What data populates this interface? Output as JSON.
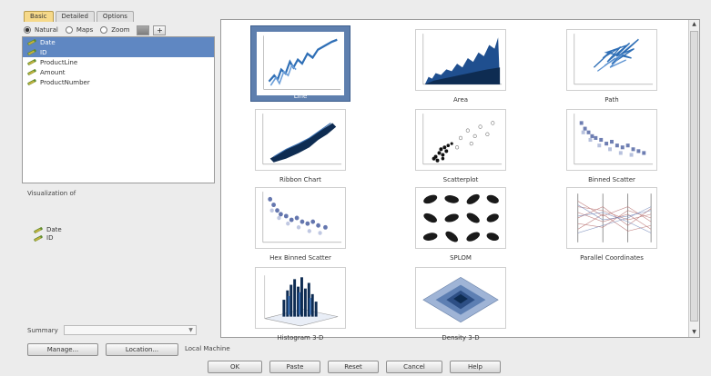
{
  "tabs": [
    {
      "label": "Basic",
      "active": true
    },
    {
      "label": "Detailed",
      "active": false
    },
    {
      "label": "Options",
      "active": false
    }
  ],
  "viz_type": {
    "options": [
      {
        "label": "Natural",
        "checked": true
      },
      {
        "label": "Maps",
        "checked": false
      },
      {
        "label": "Zoom",
        "checked": false
      }
    ],
    "btn1": "",
    "btn2": "+"
  },
  "fields": [
    {
      "label": "Date",
      "selected": true
    },
    {
      "label": "ID",
      "selected": true
    },
    {
      "label": "ProductLine",
      "selected": false
    },
    {
      "label": "Amount",
      "selected": false
    },
    {
      "label": "ProductNumber",
      "selected": false
    }
  ],
  "visualization_of": {
    "label": "Visualization of",
    "items": [
      "Date",
      "ID"
    ]
  },
  "summary": {
    "label": "Summary",
    "value": ""
  },
  "location_buttons": {
    "manage": "Manage...",
    "location": "Location...",
    "local": "Local Machine"
  },
  "dialog_buttons": {
    "ok": "OK",
    "paste": "Paste",
    "reset": "Reset",
    "cancel": "Cancel",
    "help": "Help"
  },
  "gallery": [
    {
      "label": "Line",
      "icon": "line-chart-thumbnail",
      "selected": true
    },
    {
      "label": "Area",
      "icon": "area-chart-thumbnail",
      "selected": false
    },
    {
      "label": "Path",
      "icon": "path-chart-thumbnail",
      "selected": false
    },
    {
      "label": "Ribbon Chart",
      "icon": "ribbon-chart-thumbnail",
      "selected": false
    },
    {
      "label": "Scatterplot",
      "icon": "scatterplot-thumbnail",
      "selected": false
    },
    {
      "label": "Binned Scatter",
      "icon": "binned-scatter-thumbnail",
      "selected": false
    },
    {
      "label": "Hex Binned Scatter",
      "icon": "hex-binned-scatter-thumbnail",
      "selected": false
    },
    {
      "label": "SPLOM",
      "icon": "splom-thumbnail",
      "selected": false
    },
    {
      "label": "Parallel Coordinates",
      "icon": "parallel-coordinates-thumbnail",
      "selected": false
    },
    {
      "label": "Histogram 3-D",
      "icon": "histogram-3d-thumbnail",
      "selected": false
    },
    {
      "label": "Density 3-D",
      "icon": "density-3d-thumbnail",
      "selected": false
    }
  ],
  "colors": {
    "accent": "#5f87c2",
    "selected_frame": "#5e7fae",
    "tab_active": "#f6d98a",
    "plot_blue": "#2f6fb6",
    "plot_dark": "#0e2c52"
  }
}
